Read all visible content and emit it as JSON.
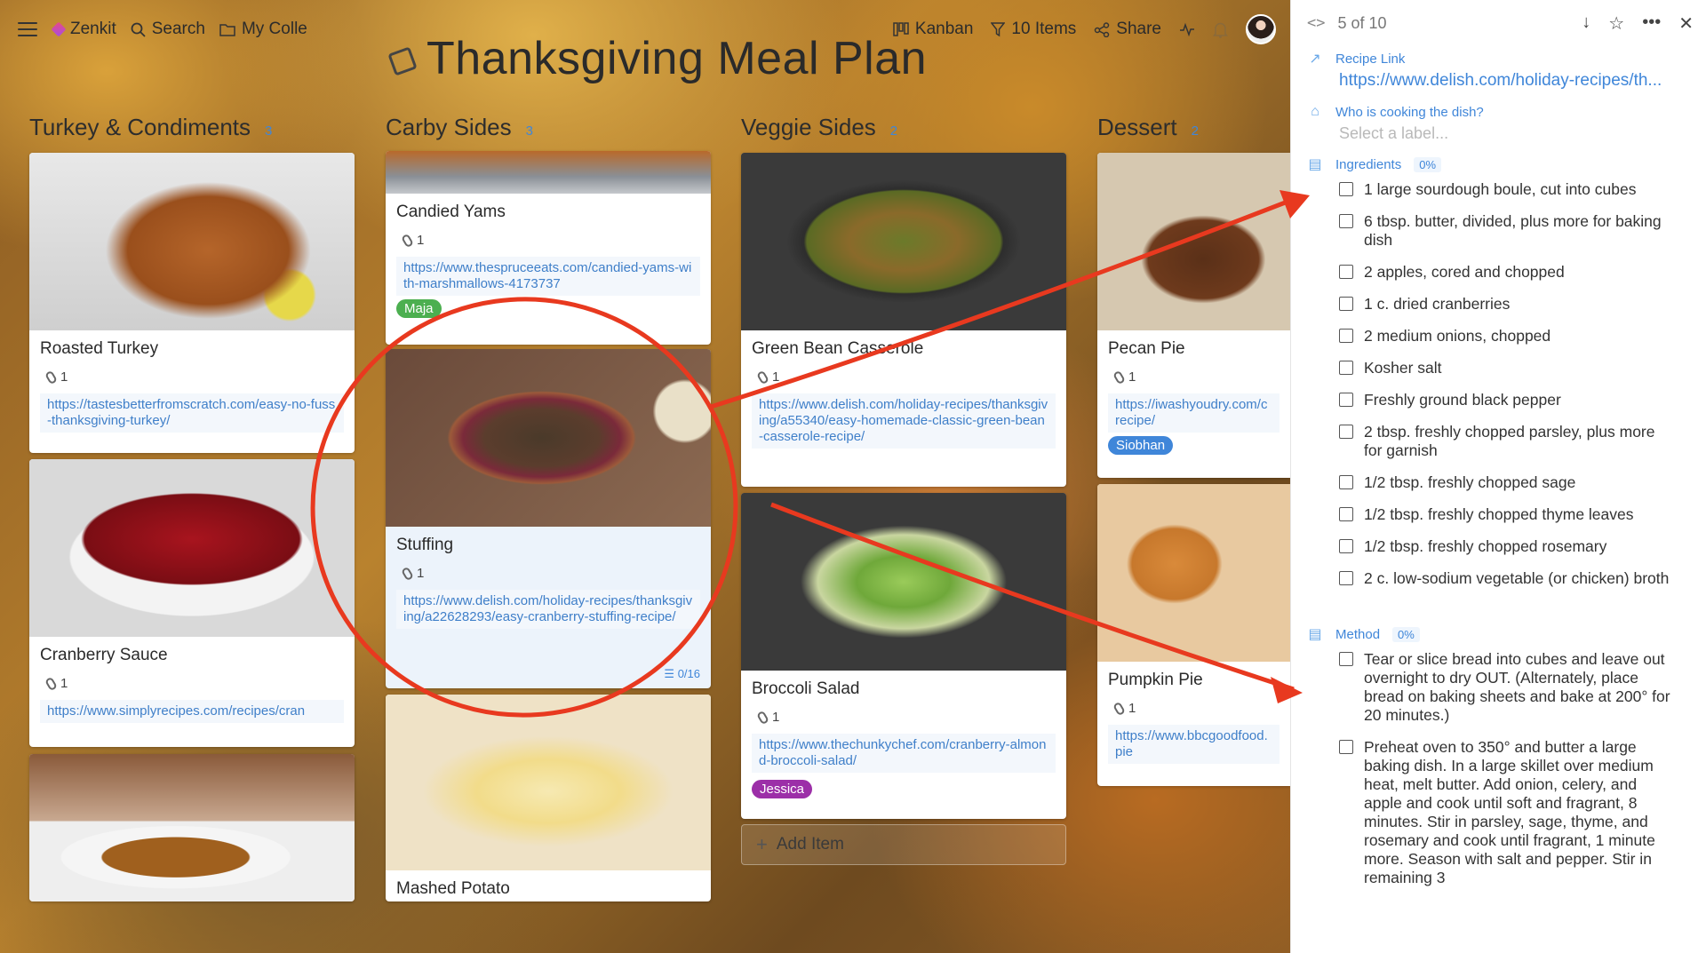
{
  "app": {
    "brand": "Zenkit",
    "search_label": "Search",
    "collection_label": "My Colle",
    "view_label": "Kanban",
    "filter_label": "10 Items",
    "share_label": "Share",
    "page_title": "Thanksgiving Meal Plan"
  },
  "columns": [
    {
      "title": "Turkey & Condiments",
      "count": "3",
      "cards": [
        {
          "title": "Roasted Turkey",
          "attachments": "1",
          "link": "https://tastesbetterfromscratch.com/easy-no-fuss-thanksgiving-turkey/",
          "image": "turkey-photo"
        },
        {
          "title": "Cranberry Sauce",
          "attachments": "1",
          "link": "https://www.simplyrecipes.com/recipes/cran",
          "image": "cranberry-sauce-photo"
        },
        {
          "title": "",
          "image": "gravy-photo"
        }
      ]
    },
    {
      "title": "Carby Sides",
      "count": "3",
      "cards": [
        {
          "title": "Candied Yams",
          "attachments": "1",
          "link": "https://www.thespruceeats.com/candied-yams-with-marshmallows-4173737",
          "badge": "Maja",
          "image": "yams-photo"
        },
        {
          "title": "Stuffing",
          "attachments": "1",
          "link": "https://www.delish.com/holiday-recipes/thanksgiving/a22628293/easy-cranberry-stuffing-recipe/",
          "checklist": "0/16",
          "image": "stuffing-photo"
        },
        {
          "title": "Mashed Potato",
          "image": "mashed-potato-photo"
        }
      ]
    },
    {
      "title": "Veggie Sides",
      "count": "2",
      "cards": [
        {
          "title": "Green Bean Casserole",
          "attachments": "1",
          "link": "https://www.delish.com/holiday-recipes/thanksgiving/a55340/easy-homemade-classic-green-bean-casserole-recipe/",
          "image": "green-bean-casserole-photo"
        },
        {
          "title": "Broccoli Salad",
          "attachments": "1",
          "link": "https://www.thechunkychef.com/cranberry-almond-broccoli-salad/",
          "badge": "Jessica",
          "image": "broccoli-salad-photo"
        }
      ],
      "add_item": "Add Item"
    },
    {
      "title": "Dessert",
      "count": "2",
      "cards": [
        {
          "title": "Pecan Pie",
          "attachments": "1",
          "link": "https://iwashyoudry.com/c recipe/",
          "badge": "Siobhan",
          "image": "pecan-pie-photo"
        },
        {
          "title": "Pumpkin Pie",
          "attachments": "1",
          "link": "https://www.bbcgoodfood. pie",
          "image": "pumpkin-pie-photo"
        }
      ]
    }
  ],
  "panel": {
    "position": "5 of 10",
    "recipe_link_label": "Recipe Link",
    "recipe_link": "https://www.delish.com/holiday-recipes/th...",
    "cook_label": "Who is cooking the dish?",
    "cook_placeholder": "Select a label...",
    "ingredients_label": "Ingredients",
    "ingredients_pct": "0%",
    "ingredients": [
      "1 large sourdough boule, cut into cubes",
      "6 tbsp. butter, divided, plus more for baking dish",
      "2 apples, cored and chopped",
      "1 c. dried cranberries",
      "2 medium onions, chopped",
      "Kosher salt",
      "Freshly ground black pepper",
      "2 tbsp. freshly chopped parsley, plus more for garnish",
      "1/2 tbsp. freshly chopped sage",
      "1/2 tbsp. freshly chopped thyme leaves",
      "1/2 tbsp. freshly chopped rosemary",
      "2 c. low-sodium vegetable (or chicken) broth"
    ],
    "method_label": "Method",
    "method_pct": "0%",
    "method": [
      "Tear or slice bread into cubes and leave out overnight to dry OUT. (Alternately, place bread on baking sheets and bake at 200° for 20 minutes.)",
      "Preheat oven to 350° and butter a large baking dish. In a large skillet over medium heat, melt butter. Add onion, celery, and apple and cook until soft and fragrant, 8 minutes. Stir in parsley, sage, thyme, and rosemary and cook until fragrant, 1 minute more. Season with salt and pepper. Stir in remaining 3"
    ]
  },
  "colors": {
    "accent": "#3f86d9",
    "annotation_red": "#e8391f",
    "badge_maja": "#4caf50",
    "badge_siobhan": "#3f86d9",
    "badge_jessica": "#9c2fa8"
  }
}
